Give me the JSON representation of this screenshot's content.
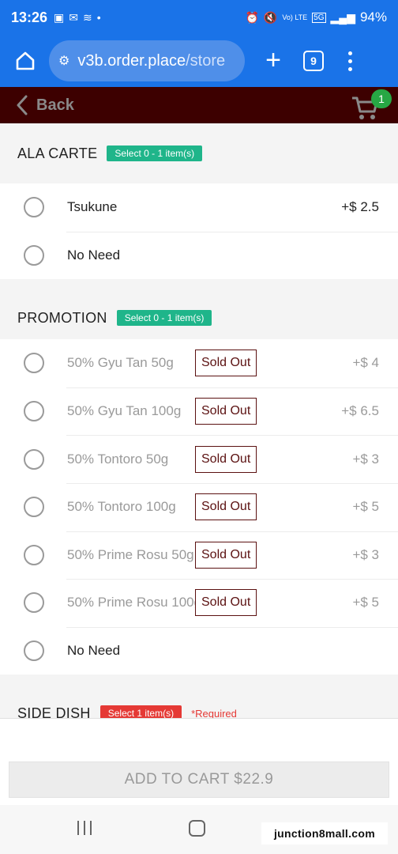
{
  "status_bar": {
    "time": "13:26",
    "battery": "94%",
    "network": "5G",
    "volte": "Vo) LTE"
  },
  "browser": {
    "url_host": "v3b.order.place",
    "url_path": "/store",
    "tab_count": "9"
  },
  "app_header": {
    "back_label": "Back",
    "cart_count": "1",
    "colors": {
      "header_bg": "#3d0000",
      "badge": "#27a744"
    }
  },
  "sections": [
    {
      "title": "ALA CARTE",
      "badge": "Select 0 - 1 item(s)",
      "options": [
        {
          "name": "Tsukune",
          "price": "+$ 2.5",
          "sold_out": false
        },
        {
          "name": "No Need",
          "price": "",
          "sold_out": false
        }
      ]
    },
    {
      "title": "PROMOTION",
      "badge": "Select 0 - 1 item(s)",
      "options": [
        {
          "name": "50% Gyu Tan 50g",
          "price": "+$ 4",
          "sold_out": true
        },
        {
          "name": "50% Gyu Tan 100g",
          "price": "+$ 6.5",
          "sold_out": true
        },
        {
          "name": "50% Tontoro 50g",
          "price": "+$ 3",
          "sold_out": true
        },
        {
          "name": "50% Tontoro 100g",
          "price": "+$ 5",
          "sold_out": true
        },
        {
          "name": "50% Prime Rosu 50g",
          "price": "+$ 3",
          "sold_out": true
        },
        {
          "name": "50% Prime Rosu 100g",
          "price": "+$ 5",
          "sold_out": true
        },
        {
          "name": "No Need",
          "price": "",
          "sold_out": false
        }
      ]
    },
    {
      "title": "SIDE DISH",
      "badge": "Select 1 item(s)",
      "required": "*Required"
    }
  ],
  "sold_out_label": "Sold Out",
  "add_to_cart": "ADD TO CART $22.9",
  "watermark": "junction8mall.com"
}
